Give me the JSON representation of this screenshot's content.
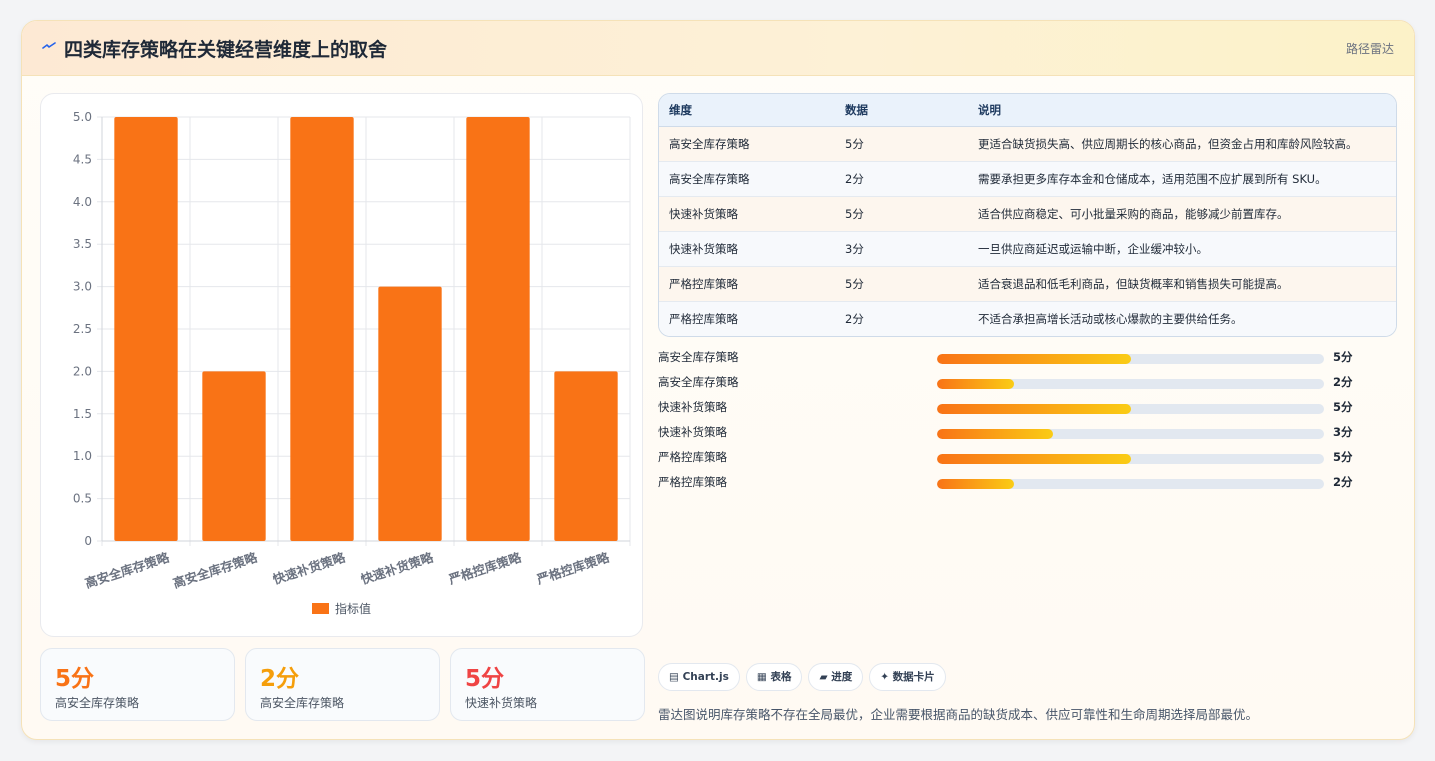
{
  "header": {
    "icon": "lightning-icon",
    "title": "四类库存策略在关键经营维度上的取舍",
    "tag": "路径雷达"
  },
  "colors": {
    "bar": "#f97316",
    "accent_orange": "#f97316",
    "accent_amber": "#f59e0b",
    "accent_red": "#ef4444"
  },
  "chart_data": {
    "type": "bar",
    "categories": [
      "高安全库存策略",
      "高安全库存策略",
      "快速补货策略",
      "快速补货策略",
      "严格控库策略",
      "严格控库策略"
    ],
    "series": [
      {
        "name": "指标值",
        "values": [
          5,
          2,
          5,
          3,
          5,
          2
        ]
      }
    ],
    "ylim": [
      0,
      5
    ],
    "yticks": [
      "0",
      "0.5",
      "1.0",
      "1.5",
      "2.0",
      "2.5",
      "3.0",
      "3.5",
      "4.0",
      "4.5",
      "5.0"
    ],
    "grid": true,
    "legend": "bottom"
  },
  "stats": [
    {
      "value": "5分",
      "label": "高安全库存策略",
      "color": "#f97316"
    },
    {
      "value": "2分",
      "label": "高安全库存策略",
      "color": "#f59e0b"
    },
    {
      "value": "5分",
      "label": "快速补货策略",
      "color": "#ef4444"
    }
  ],
  "table": {
    "headers": [
      "维度",
      "数据",
      "说明"
    ],
    "rows": [
      [
        "高安全库存策略",
        "5分",
        "更适合缺货损失高、供应周期长的核心商品，但资金占用和库龄风险较高。"
      ],
      [
        "高安全库存策略",
        "2分",
        "需要承担更多库存本金和仓储成本，适用范围不应扩展到所有 SKU。"
      ],
      [
        "快速补货策略",
        "5分",
        "适合供应商稳定、可小批量采购的商品，能够减少前置库存。"
      ],
      [
        "快速补货策略",
        "3分",
        "一旦供应商延迟或运输中断，企业缓冲较小。"
      ],
      [
        "严格控库策略",
        "5分",
        "适合衰退品和低毛利商品，但缺货概率和销售损失可能提高。"
      ],
      [
        "严格控库策略",
        "2分",
        "不适合承担高增长活动或核心爆款的主要供给任务。"
      ]
    ]
  },
  "progress": [
    {
      "label": "高安全库存策略",
      "value": 5,
      "max": 10,
      "text": "5分"
    },
    {
      "label": "高安全库存策略",
      "value": 2,
      "max": 10,
      "text": "2分"
    },
    {
      "label": "快速补货策略",
      "value": 5,
      "max": 10,
      "text": "5分"
    },
    {
      "label": "快速补货策略",
      "value": 3,
      "max": 10,
      "text": "3分"
    },
    {
      "label": "严格控库策略",
      "value": 5,
      "max": 10,
      "text": "5分"
    },
    {
      "label": "严格控库策略",
      "value": 2,
      "max": 10,
      "text": "2分"
    }
  ],
  "chips": [
    "▤ Chart.js",
    "▦ 表格",
    "▰ 进度",
    "✦ 数据卡片"
  ],
  "note": "雷达图说明库存策略不存在全局最优，企业需要根据商品的缺货成本、供应可靠性和生命周期选择局部最优。"
}
